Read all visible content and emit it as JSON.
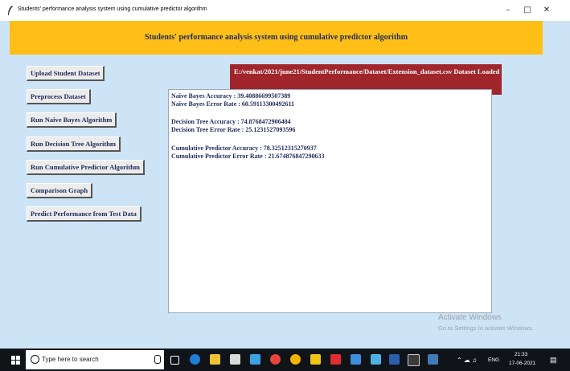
{
  "window": {
    "title": "Students' performance analysis system using cumulative predictor algorithm",
    "minimize": "–",
    "maximize": "□",
    "close": "✕"
  },
  "header": {
    "title": "Students' performance analysis system using cumulative predictor algorithm",
    "color": "#ffbf17"
  },
  "buttons": [
    "Upload Student Dataset",
    "Preprocess Dataset",
    "Run Naive Bayes Algorithm",
    "Run Decision Tree Algorithm",
    "Run Cumulative Predictor Algorithm",
    "Comparison Graph",
    "Predict Performance from Test Data"
  ],
  "status": {
    "text": "E:/venkat/2021/june21/StudentPerformance/Dataset/Extension_dataset.csv Dataset Loaded",
    "color": "#a0262c"
  },
  "output": {
    "lines": [
      "Naive Bayes Accuracy  : 39.40886699507389",
      "Naive Bayes Error Rate : 60.59113300492611",
      "Decision Tree Accuracy   : 74.8768472906404",
      "Decision Tree Error Rate : 25.1231527093596",
      "Cumulative Predictor Accuracy   : 78.32512315270937",
      "Cumulative Predictor Error Rate : 21.674876847290633"
    ]
  },
  "watermark": {
    "line1": "Activate Windows",
    "line2": "Go to Settings to activate Windows."
  },
  "taskbar": {
    "search_placeholder": "Type here to search",
    "tray_lang": "ENG",
    "time": "21:33",
    "date": "17-06-2021",
    "icons": [
      "task-view-icon",
      "edge-icon",
      "file-explorer-icon",
      "store-icon",
      "app-icon",
      "settings-icon",
      "chrome-icon",
      "files-icon",
      "pdf-icon",
      "notepad-icon",
      "paint-icon",
      "word-icon",
      "terminal-icon",
      "python-icon"
    ]
  }
}
